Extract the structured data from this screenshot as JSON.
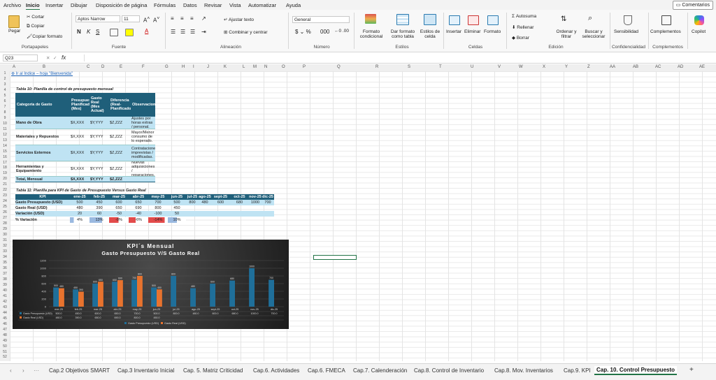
{
  "menu": [
    "Archivo",
    "Inicio",
    "Insertar",
    "Dibujar",
    "Disposición de página",
    "Fórmulas",
    "Datos",
    "Revisar",
    "Vista",
    "Automatizar",
    "Ayuda"
  ],
  "comments_label": "Comentarios",
  "ribbon": {
    "paste": "Pegar",
    "cut": "Cortar",
    "copy": "Copiar",
    "format_painter": "Copiar formato",
    "clipboard_group": "Portapapeles",
    "font_name": "Aptos Narrow",
    "font_size": "11",
    "font_group": "Fuente",
    "wrap_text": "Ajustar texto",
    "merge_center": "Combinar y centrar",
    "alignment_group": "Alineación",
    "number_format": "General",
    "number_group": "Número",
    "cond_format": "Formato condicional",
    "format_table": "Dar formato como tabla",
    "cell_styles": "Estilos de celda",
    "styles_group": "Estilos",
    "insert": "Insertar",
    "delete": "Eliminar",
    "format": "Formato",
    "cells_group": "Celdas",
    "autosum": "Autosuma",
    "fill": "Rellenar",
    "clear": "Borrar",
    "sort_filter": "Ordenar y filtrar",
    "find_select": "Buscar y seleccionar",
    "editing_group": "Edición",
    "sensitivity": "Sensibilidad",
    "confidentiality_group": "Confidencialidad",
    "addins": "Complementos",
    "addins_group": "Complementos",
    "copilot": "Copilot"
  },
  "formula_bar": {
    "name_box": "Q23",
    "fx": "fx",
    "value": ""
  },
  "columns": [
    "A",
    "B",
    "C",
    "D",
    "E",
    "F",
    "G",
    "H",
    "I",
    "J",
    "K",
    "L",
    "M",
    "N",
    "O",
    "P",
    "Q",
    "R",
    "S",
    "T",
    "U",
    "V",
    "W",
    "X",
    "Y",
    "Z",
    "AA",
    "AB",
    "AC",
    "AD",
    "AE"
  ],
  "rows": [
    "1",
    "2",
    "3",
    "4",
    "5",
    "6",
    "7",
    "8",
    "9",
    "10",
    "11",
    "12",
    "13",
    "14",
    "15",
    "16",
    "17",
    "18",
    "19",
    "20",
    "21",
    "22",
    "23",
    "24",
    "25",
    "26",
    "27",
    "28",
    "29",
    "30",
    "31",
    "32",
    "33",
    "34",
    "35",
    "36",
    "37",
    "38",
    "39",
    "40",
    "41",
    "42",
    "43",
    "44",
    "45",
    "46",
    "47",
    "48",
    "49",
    "50",
    "51",
    "52"
  ],
  "link_text": "Ir al Índice – hoja \"Bienvenida\"",
  "table10": {
    "title": "Tabla 10: Planilla de control de presupuesto mensual",
    "headers": [
      "Categoría de Gasto",
      "Presupuesto Planificado (Mes)",
      "Gasto Real (Mes Actual)",
      "Diferencia (Real-Planificado)",
      "Observaciones"
    ],
    "rows": [
      [
        "Mano de Obra",
        "$X,XXX",
        "$Y,YYY",
        "$Z,ZZZ",
        "Ajustes por horas extras / personal."
      ],
      [
        "Materiales y Repuestos",
        "$X,XXX",
        "$Y,YYY",
        "$Z,ZZZ",
        "Mayor/Menor consumo de lo esperado."
      ],
      [
        "Servicios Externos",
        "$X,XXX",
        "$Y,YYY",
        "$Z,ZZZ",
        "Contrataciones imprevistas / modificadas."
      ],
      [
        "Herramientas y Equipamiento",
        "$X,XXX",
        "$Y,YYY",
        "$Z,ZZZ",
        "Nuevas adquisiciones / reparaciones."
      ],
      [
        "Total, Mensual",
        "$X,XXX",
        "$Y,YYY",
        "$Z,ZZZ",
        ""
      ]
    ]
  },
  "table11": {
    "title": "Tabla 11: Planilla para KPI de Gasto de Presupuesto Versus Gasto Real",
    "headers": [
      "KPI",
      "ene-25",
      "feb-25",
      "mar-25",
      "abr-25",
      "may-25",
      "jun-25",
      "jul-25",
      "ago-25",
      "sept-25",
      "oct-25",
      "nov-25",
      "dic-25"
    ],
    "rows": [
      [
        "Gasto Presupuesto (USD)",
        "500",
        "450",
        "600",
        "650",
        "700",
        "500",
        "800",
        "480",
        "600",
        "680",
        "1000",
        "700"
      ],
      [
        "Gasto Real (USD)",
        "480",
        "390",
        "650",
        "690",
        "800",
        "450",
        "",
        "",
        "",
        "",
        "",
        ""
      ],
      [
        "Variación (USD)",
        "20",
        "60",
        "-50",
        "-40",
        "-100",
        "50",
        "",
        "",
        "",
        "",
        "",
        ""
      ],
      [
        "% Variación",
        "4%",
        "13%",
        "-8%",
        "-6%",
        "-14%",
        "10%",
        "",
        "",
        "",
        "",
        "",
        ""
      ]
    ]
  },
  "chart_data": {
    "type": "bar",
    "title": "KPI´s Mensual",
    "subtitle": "Gasto Presupuesto V/S Gasto Real",
    "categories": [
      "ene-25",
      "feb-25",
      "mar-25",
      "abr-25",
      "may-25",
      "jun-25",
      "jul-25",
      "ago-25",
      "sept-25",
      "oct-25",
      "nov-25",
      "dic-25"
    ],
    "series": [
      {
        "name": "Gasto Presupuesto (USD)",
        "color": "#1f6f9a",
        "values": [
          500,
          450,
          600,
          650,
          700,
          500,
          800,
          480,
          600,
          680,
          1000,
          700
        ]
      },
      {
        "name": "Gasto Real (USD)",
        "color": "#e8732e",
        "values": [
          480,
          390,
          650,
          690,
          800,
          450,
          null,
          null,
          null,
          null,
          null,
          null
        ]
      }
    ],
    "ylim": [
      0,
      1200
    ],
    "yticks": [
      "0",
      "200",
      "400",
      "600",
      "800",
      "1000",
      "1200"
    ],
    "legend": "bottom",
    "grid": true
  },
  "sheet_tabs": [
    "Cap.2 Objetivos SMART",
    "Cap.3 Inventario Inicial",
    "Cap. 5. Matriz Criticidad",
    "Cap.6. Actividades",
    "Cap.6. FMECA",
    "Cap.7. Calenderación",
    "Cap.8. Control de Inventario",
    "Cap.8. Mov. Inventarios",
    "Cap.9. KPI",
    "Cap. 10. Control Presupuesto"
  ],
  "active_tab": "Cap. 10. Control Presupuesto"
}
